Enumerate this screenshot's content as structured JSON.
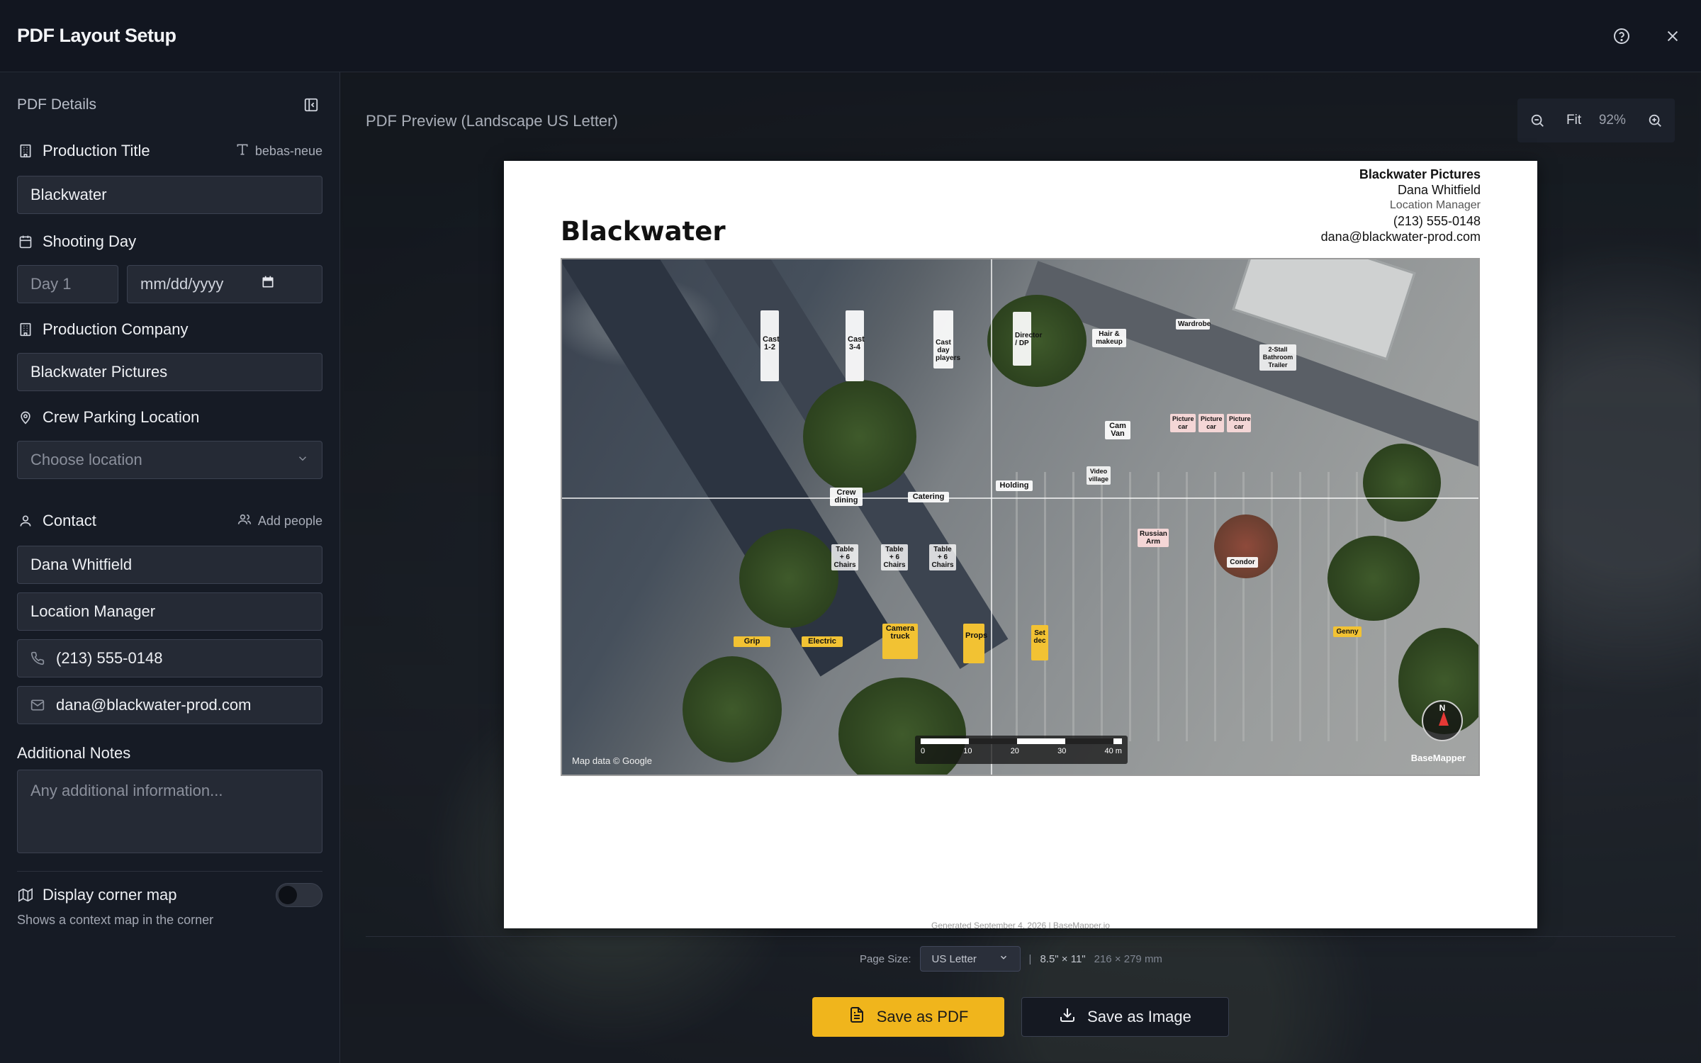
{
  "header": {
    "title": "PDF Layout Setup"
  },
  "sidebar": {
    "title": "PDF Details",
    "production_title": {
      "label": "Production Title",
      "font_label": "bebas-neue",
      "value": "Blackwater"
    },
    "shooting_day": {
      "label": "Shooting Day",
      "day_placeholder": "Day 1",
      "date_placeholder": "mm/dd/yyyy"
    },
    "production_company": {
      "label": "Production Company",
      "value": "Blackwater Pictures"
    },
    "crew_parking": {
      "label": "Crew Parking Location",
      "placeholder": "Choose location"
    },
    "contact": {
      "label": "Contact",
      "add_people": "Add people",
      "name": "Dana Whitfield",
      "role": "Location Manager",
      "phone": "(213) 555-0148",
      "email": "dana@blackwater-prod.com"
    },
    "notes": {
      "label": "Additional Notes",
      "placeholder": "Any additional information..."
    },
    "corner_map": {
      "label": "Display corner map",
      "hint": "Shows a context map in the corner",
      "enabled": false
    }
  },
  "preview": {
    "label": "PDF Preview (Landscape US Letter)",
    "zoom": {
      "fit_label": "Fit",
      "value": "92%"
    },
    "doc": {
      "title": "Blackwater",
      "company": "Blackwater Pictures",
      "contact_name": "Dana Whitfield",
      "contact_role": "Location Manager",
      "contact_phone": "(213) 555-0148",
      "contact_email": "dana@blackwater-prod.com",
      "footer": "Generated September 4, 2026 | BaseMapper.io"
    },
    "map": {
      "markers": {
        "cast12": "Cast 1-2",
        "cast34": "Cast 3-4",
        "castday": "Cast day players",
        "director": "Director / DP",
        "hair": "Hair & makeup",
        "wardrobe": "Wardrobe",
        "bathroom": "2-Stall Bathroom Trailer",
        "camvan": "Cam Van",
        "picture1": "Picture car",
        "picture2": "Picture car",
        "picture3": "Picture car",
        "video": "Video village",
        "holding": "Holding",
        "catering": "Catering",
        "crew": "Crew dining",
        "table1": "Table + 6 Chairs",
        "table2": "Table + 6 Chairs",
        "table3": "Table + 6 Chairs",
        "russian": "Russian Arm",
        "condor": "Condor",
        "genny": "Genny",
        "grip": "Grip",
        "electric": "Electric",
        "camtruck": "Camera truck",
        "props": "Props",
        "setdec": "Set dec"
      },
      "scale_ticks": [
        "0",
        "10",
        "20",
        "30",
        "40 m"
      ],
      "compass": "N",
      "credit": "Map data © Google",
      "brand": "BaseMapper"
    },
    "page_size": {
      "label": "Page Size:",
      "value": "US Letter",
      "dimensions": "8.5\" × 11\"",
      "mm": "216 × 279 mm"
    }
  },
  "actions": {
    "save_pdf": "Save as PDF",
    "save_image": "Save as Image"
  },
  "colors": {
    "accent": "#f0b51c",
    "sidebar_bg": "#161b25",
    "field_bg": "#252a35"
  }
}
